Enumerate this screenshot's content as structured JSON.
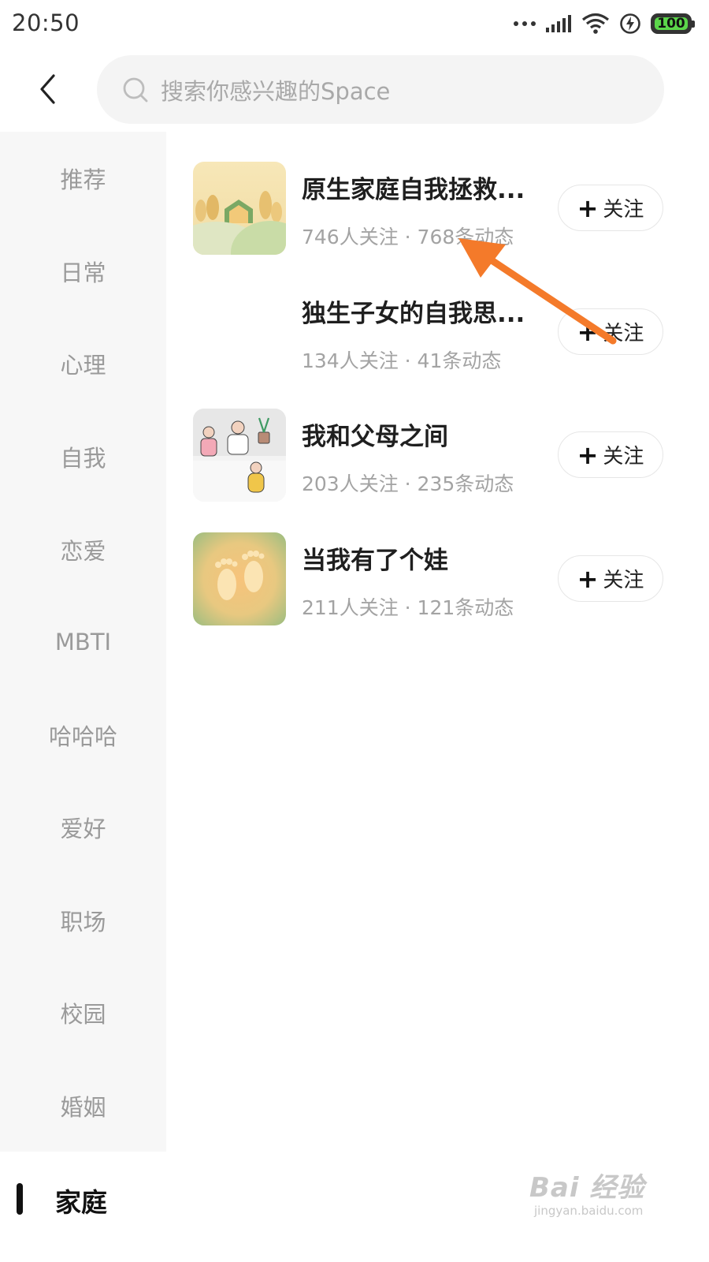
{
  "status_bar": {
    "time": "20:50",
    "battery": "100",
    "icons": [
      "more-dots-icon",
      "signal-icon",
      "wifi-icon",
      "charging-icon",
      "battery-icon"
    ],
    "battery_color": "#5bd64a"
  },
  "header": {
    "back_icon": "back-chevron-icon",
    "search_placeholder": "搜索你感兴趣的Space"
  },
  "sidebar": {
    "items": [
      {
        "label": "推荐"
      },
      {
        "label": "日常"
      },
      {
        "label": "心理"
      },
      {
        "label": "自我"
      },
      {
        "label": "恋爱"
      },
      {
        "label": "MBTI"
      },
      {
        "label": "哈哈哈"
      },
      {
        "label": "爱好"
      },
      {
        "label": "职场"
      },
      {
        "label": "校园"
      },
      {
        "label": "婚姻"
      }
    ],
    "active": "家庭"
  },
  "spaces": [
    {
      "title": "原生家庭自我拯救...",
      "stats": "746人关注 · 768条动态",
      "button": "关注"
    },
    {
      "title": "独生子女的自我思...",
      "stats": "134人关注 · 41条动态",
      "button": "关注"
    },
    {
      "title": "我和父母之间",
      "stats": "203人关注 · 235条动态",
      "button": "关注"
    },
    {
      "title": "当我有了个娃",
      "stats": "211人关注 · 121条动态",
      "button": "关注"
    }
  ],
  "annotation": {
    "color": "#f47a2a"
  },
  "watermark": {
    "logo": "Bai 经验",
    "url": "jingyan.baidu.com"
  }
}
